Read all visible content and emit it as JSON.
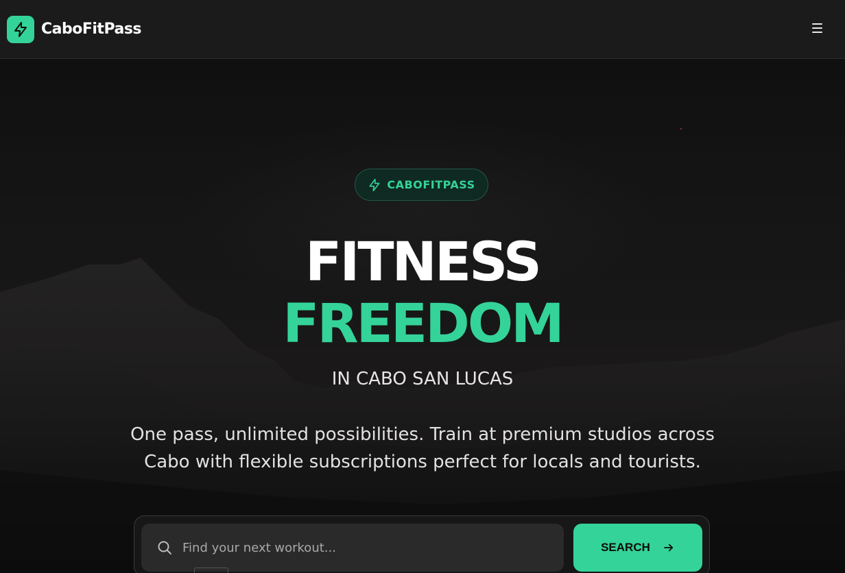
{
  "nav": {
    "brand": "CaboFitPass",
    "logo_icon": "bolt-icon",
    "menu_icon": "hamburger-menu-icon"
  },
  "hero": {
    "badge": "CABOFITPASS",
    "badge_icon": "bolt-icon",
    "title_line1": "FITNESS",
    "title_line2": "FREEDOM",
    "subtitle": "IN CABO SAN LUCAS",
    "description": "One pass, unlimited possibilities. Train at premium studios across Cabo with flexible subscriptions perfect for locals and tourists."
  },
  "search": {
    "placeholder": "Find your next workout...",
    "button_label": "SEARCH",
    "search_icon": "search-icon",
    "arrow_icon": "arrow-right-icon"
  },
  "colors": {
    "accent": "#34d399",
    "background": "#121212",
    "navbar": "#1b1b1b"
  }
}
